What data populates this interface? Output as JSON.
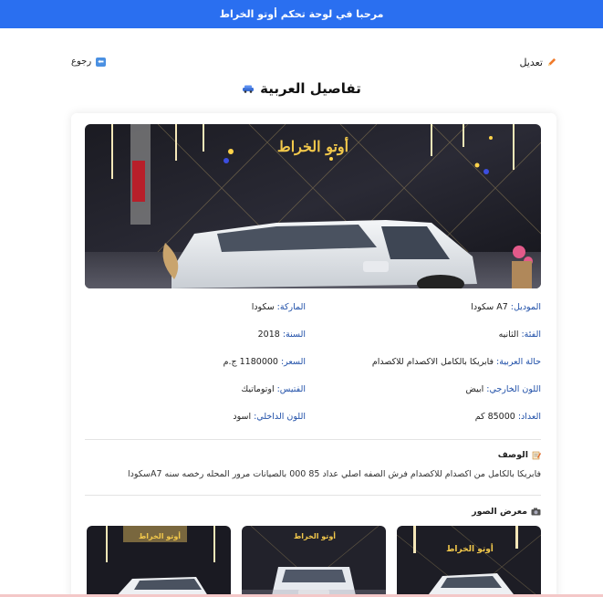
{
  "header": {
    "welcome": "مرحبا في لوحة تحكم أوتو الخراط"
  },
  "toolbar": {
    "edit_label": "تعديل",
    "back_label": "رجوع"
  },
  "page": {
    "title": "تفاصيل العربية"
  },
  "hero": {
    "sign_text": "أوتو الخراط"
  },
  "details": {
    "model": {
      "label": "الموديل:",
      "value": "A7 سكودا"
    },
    "brand": {
      "label": "الماركة:",
      "value": "سكودا"
    },
    "category": {
      "label": "الفئة:",
      "value": "الثانيه"
    },
    "year": {
      "label": "السنة:",
      "value": "2018"
    },
    "condition": {
      "label": "حالة العربية:",
      "value": "فابريكا بالكامل الاكصدام للاكصدام"
    },
    "price": {
      "label": "السعر:",
      "value": "1180000 ج.م"
    },
    "exterior_color": {
      "label": "اللون الخارجي:",
      "value": "ابيض"
    },
    "transmission": {
      "label": "الفتيس:",
      "value": "اوتوماتيك"
    },
    "mileage": {
      "label": "العداد:",
      "value": "85000 كم"
    },
    "interior_color": {
      "label": "اللون الداخلي:",
      "value": "اسود"
    }
  },
  "description": {
    "title": "الوصف",
    "text": "فابريكا بالكامل من اكصدام للاكصدام فرش الصفه اصلي عداد 85 000 بالصيانات مرور المحله رخصه سنه A7سكودا"
  },
  "gallery": {
    "title": "معرض الصور"
  },
  "colors": {
    "topbar": "#2a6ff0",
    "label": "#1f4fa8"
  }
}
